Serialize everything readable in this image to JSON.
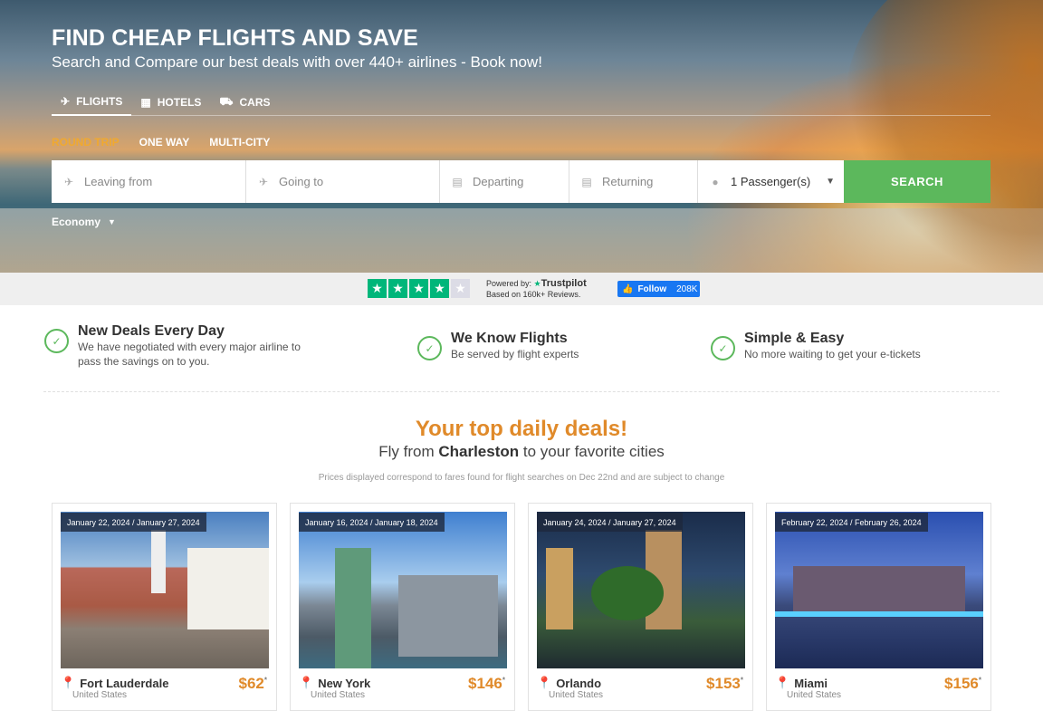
{
  "hero": {
    "title": "FIND CHEAP FLIGHTS AND SAVE",
    "subtitle": "Search and Compare our best deals with over 440+ airlines - Book now!"
  },
  "tabs": [
    {
      "label": "FLIGHTS",
      "icon": "plane-icon"
    },
    {
      "label": "HOTELS",
      "icon": "hotel-icon"
    },
    {
      "label": "CARS",
      "icon": "car-icon"
    }
  ],
  "trip_types": [
    "ROUND TRIP",
    "ONE WAY",
    "MULTI-CITY"
  ],
  "search": {
    "leaving_placeholder": "Leaving from",
    "going_placeholder": "Going to",
    "departing_placeholder": "Departing",
    "returning_placeholder": "Returning",
    "passengers": "1 Passenger(s)",
    "button": "SEARCH",
    "cabin": "Economy"
  },
  "trust": {
    "powered_by": "Powered by:",
    "brand": "Trustpilot",
    "based_on": "Based on 160k+ Reviews.",
    "rating": 4,
    "fb_label": "Follow",
    "fb_count": "208K"
  },
  "features": [
    {
      "title": "New Deals Every Day",
      "text": "We have negotiated with every major airline to pass the savings on to you."
    },
    {
      "title": "We Know Flights",
      "text": "Be served by flight experts"
    },
    {
      "title": "Simple & Easy",
      "text": "No more waiting to get your e-tickets"
    }
  ],
  "deals": {
    "title": "Your top daily deals!",
    "sub_pre": "Fly from",
    "sub_city": "Charleston",
    "sub_post": "to your favorite cities",
    "note": "Prices displayed correspond to fares found for flight searches on Dec 22nd and are subject to change",
    "cards": [
      {
        "date": "January 22, 2024 / January 27, 2024",
        "city": "Fort Lauderdale",
        "country": "United States",
        "price": "$62"
      },
      {
        "date": "January 16, 2024 / January 18, 2024",
        "city": "New York",
        "country": "United States",
        "price": "$146"
      },
      {
        "date": "January 24, 2024 / January 27, 2024",
        "city": "Orlando",
        "country": "United States",
        "price": "$153"
      },
      {
        "date": "February 22, 2024 / February 26, 2024",
        "city": "Miami",
        "country": "United States",
        "price": "$156"
      }
    ],
    "asterisk": "*"
  },
  "colors": {
    "accent": "#e08a2a",
    "green": "#5cb85c",
    "trustpilot": "#00b67a",
    "facebook": "#1877f2"
  }
}
